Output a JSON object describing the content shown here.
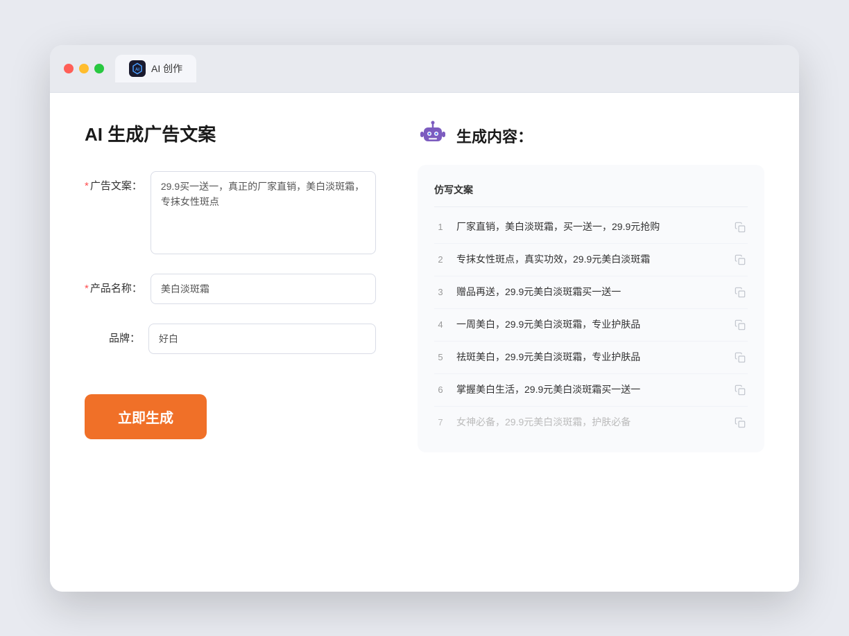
{
  "browser": {
    "tab_label": "AI 创作",
    "tab_icon": "AI"
  },
  "left_panel": {
    "title": "AI 生成广告文案",
    "form": {
      "ad_copy_label": "广告文案：",
      "ad_copy_required": true,
      "ad_copy_value": "29.9买一送一，真正的厂家直销，美白淡斑霜，专抹女性斑点",
      "product_name_label": "产品名称：",
      "product_name_required": true,
      "product_name_value": "美白淡斑霜",
      "brand_label": "品牌：",
      "brand_required": false,
      "brand_value": "好白"
    },
    "generate_button_label": "立即生成"
  },
  "right_panel": {
    "title": "生成内容：",
    "table_header": "仿写文案",
    "results": [
      {
        "num": "1",
        "text": "厂家直销，美白淡斑霜，买一送一，29.9元抢购",
        "dimmed": false
      },
      {
        "num": "2",
        "text": "专抹女性斑点，真实功效，29.9元美白淡斑霜",
        "dimmed": false
      },
      {
        "num": "3",
        "text": "赠品再送，29.9元美白淡斑霜买一送一",
        "dimmed": false
      },
      {
        "num": "4",
        "text": "一周美白，29.9元美白淡斑霜，专业护肤品",
        "dimmed": false
      },
      {
        "num": "5",
        "text": "祛斑美白，29.9元美白淡斑霜，专业护肤品",
        "dimmed": false
      },
      {
        "num": "6",
        "text": "掌握美白生活，29.9元美白淡斑霜买一送一",
        "dimmed": false
      },
      {
        "num": "7",
        "text": "女神必备，29.9元美白淡斑霜，护肤必备",
        "dimmed": true
      }
    ]
  }
}
